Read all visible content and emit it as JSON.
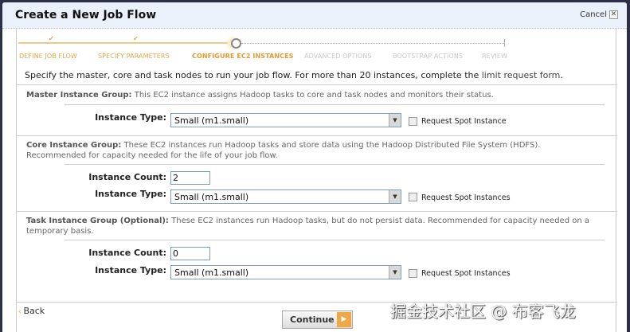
{
  "window": {
    "title": "Create a New Job Flow",
    "cancel_label": "Cancel"
  },
  "wizard": {
    "steps": [
      {
        "label": "DEFINE JOB FLOW",
        "state": "done"
      },
      {
        "label": "SPECIFY PARAMETERS",
        "state": "done"
      },
      {
        "label": "CONFIGURE EC2 INSTANCES",
        "state": "current"
      },
      {
        "label": "ADVANCED OPTIONS",
        "state": "todo"
      },
      {
        "label": "BOOTSTRAP ACTIONS",
        "state": "todo"
      },
      {
        "label": "REVIEW",
        "state": "todo"
      }
    ],
    "check_glyph": "✔"
  },
  "intro": {
    "text": "Specify the master, core and task nodes to run your job flow. For more than 20 instances, complete the ",
    "link": "limit request form",
    "end": "."
  },
  "master": {
    "title": "Master Instance Group:",
    "desc": " This EC2 instance assigns Hadoop tasks to core and task nodes and monitors their status.",
    "type_label": "Instance Type:",
    "type_value": "Small (m1.small)",
    "spot_label": "Request Spot Instance"
  },
  "core": {
    "title": "Core Instance Group:",
    "desc": " These EC2 instances run Hadoop tasks and store data using the Hadoop Distributed File System (HDFS). Recommended for capacity needed for the life of your job flow.",
    "count_label": "Instance Count:",
    "count_value": "2",
    "type_label": "Instance Type:",
    "type_value": "Small (m1.small)",
    "spot_label": "Request Spot Instances"
  },
  "task": {
    "title": "Task Instance Group (Optional):",
    "desc": " These EC2 instances run Hadoop tasks, but do not persist data. Recommended for capacity needed on a temporary basis.",
    "count_label": "Instance Count:",
    "count_value": "0",
    "type_label": "Instance Type:",
    "type_value": "Small (m1.small)",
    "spot_label": "Request Spot Instances"
  },
  "footer": {
    "back_label": "Back",
    "continue_label": "Continue"
  },
  "watermark": "掘金技术社区 @ 布客飞龙",
  "colors": {
    "accent": "#e0a948",
    "title_bar": "#eaf1fa"
  }
}
